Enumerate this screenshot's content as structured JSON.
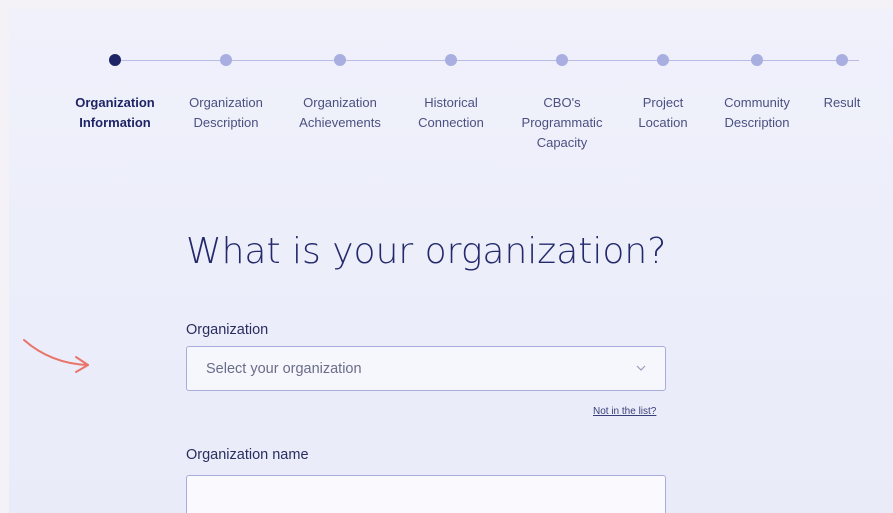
{
  "stepper": {
    "active_index": 0,
    "steps": [
      {
        "label": "Organization\nInformation"
      },
      {
        "label": "Organization\nDescription"
      },
      {
        "label": "Organization\nAchievements"
      },
      {
        "label": "Historical\nConnection"
      },
      {
        "label": "CBO's\nProgrammatic\nCapacity"
      },
      {
        "label": "Project\nLocation"
      },
      {
        "label": "Community\nDescription"
      },
      {
        "label": "Result"
      }
    ]
  },
  "form": {
    "heading": "What is your organization?",
    "organization": {
      "label": "Organization",
      "placeholder": "Select your organization",
      "icon": "chevron-down-icon"
    },
    "not_in_list_link": "Not in the list?",
    "organization_name": {
      "label": "Organization name",
      "value": ""
    }
  },
  "annotation": {
    "icon": "arrow-right-icon",
    "color": "#e8746a"
  },
  "colors": {
    "accent_dark": "#1f2466",
    "step_inactive": "#a8aee0",
    "border": "#a9addb"
  }
}
